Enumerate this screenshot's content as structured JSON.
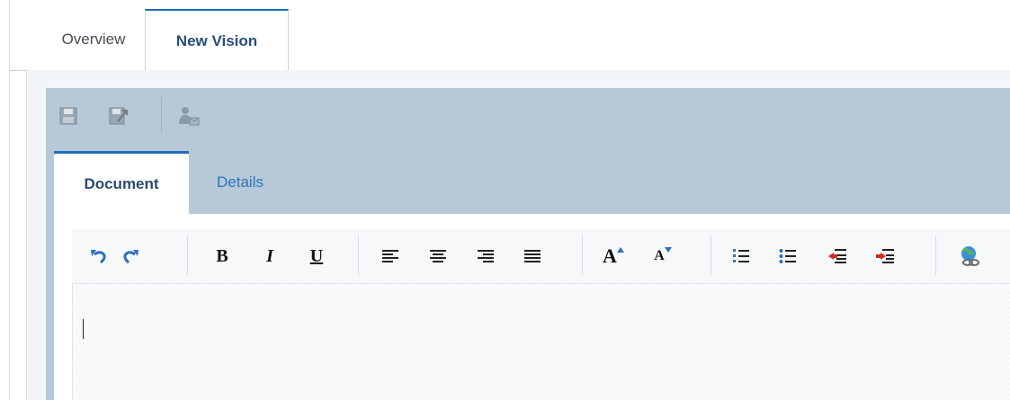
{
  "tabs": [
    {
      "label": "Overview",
      "active": false
    },
    {
      "label": "New Vision",
      "active": true
    }
  ],
  "primary_toolbar": {
    "icons": [
      "save-icon",
      "save-and-close-icon",
      "share-document-icon"
    ]
  },
  "document_tabs": [
    {
      "label": "Document",
      "active": true
    },
    {
      "label": "Details",
      "active": false
    }
  ],
  "editor_toolbar": {
    "groups": [
      [
        "undo-icon",
        "redo-icon"
      ],
      [
        "bold-icon",
        "italic-icon",
        "underline-icon"
      ],
      [
        "align-left-icon",
        "align-center-icon",
        "align-right-icon",
        "justify-icon"
      ],
      [
        "increase-font-size-icon",
        "decrease-font-size-icon"
      ],
      [
        "numbered-list-icon",
        "bulleted-list-icon",
        "outdent-icon",
        "indent-icon"
      ],
      [
        "insert-link-icon"
      ]
    ],
    "bold": "B",
    "italic": "I",
    "underline": "U",
    "font_up": "A",
    "font_down": "A"
  },
  "editor": {
    "content": ""
  },
  "colors": {
    "active_accent": "#1f6eb8",
    "header_band": "#b7c9d8",
    "link_text": "#2c73b7"
  }
}
